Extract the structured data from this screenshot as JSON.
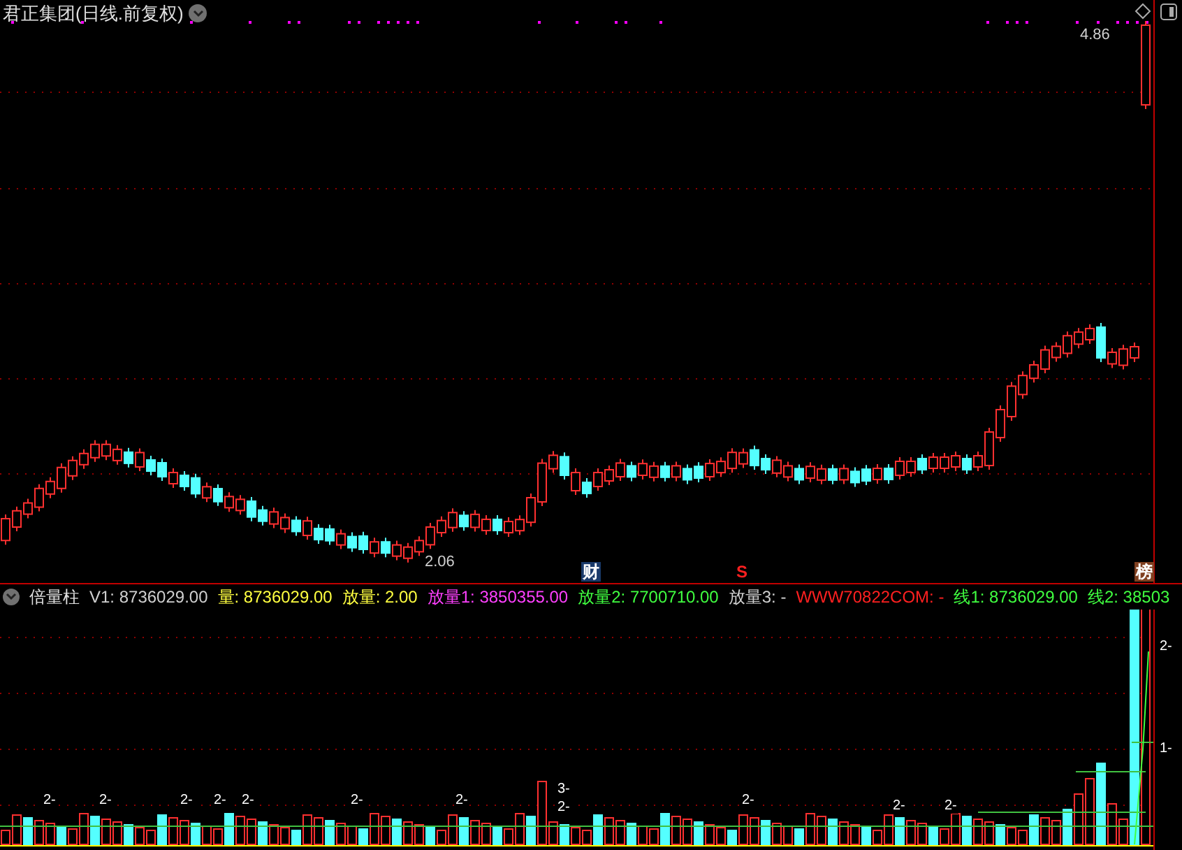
{
  "title": "君正集团(日线.前复权)",
  "price_labels": [
    {
      "kind": "high",
      "text": "4.86"
    },
    {
      "kind": "low",
      "text": "2.06"
    }
  ],
  "event_markers": [
    {
      "kind": "finance",
      "text": "财"
    },
    {
      "kind": "signal",
      "text": "S"
    },
    {
      "kind": "ranking",
      "text": "榜"
    }
  ],
  "indicator": {
    "name": "倍量柱",
    "values": [
      {
        "text": "V1: 8736029.00",
        "color": "#d0d0d0"
      },
      {
        "text": "量: 8736029.00",
        "color": "#ffff40"
      },
      {
        "text": "放量: 2.00",
        "color": "#ffff40"
      },
      {
        "text": "放量1: 3850355.00",
        "color": "#ff40ff"
      },
      {
        "text": "放量2: 7700710.00",
        "color": "#40ff40"
      },
      {
        "text": "放量3: -",
        "color": "#d0d0d0"
      },
      {
        "text": "WWW70822COM: -",
        "color": "#ff2020"
      },
      {
        "text": "线1: 8736029.00",
        "color": "#40ff40"
      },
      {
        "text": "线2: 38503",
        "color": "#40ff40"
      }
    ]
  },
  "volume_marks": [
    "2-",
    "2-",
    "2-",
    "2-",
    "2-",
    "2-",
    "2-",
    "2-",
    "2-",
    "2-",
    "3-",
    "2-",
    "2-",
    "1-"
  ]
}
